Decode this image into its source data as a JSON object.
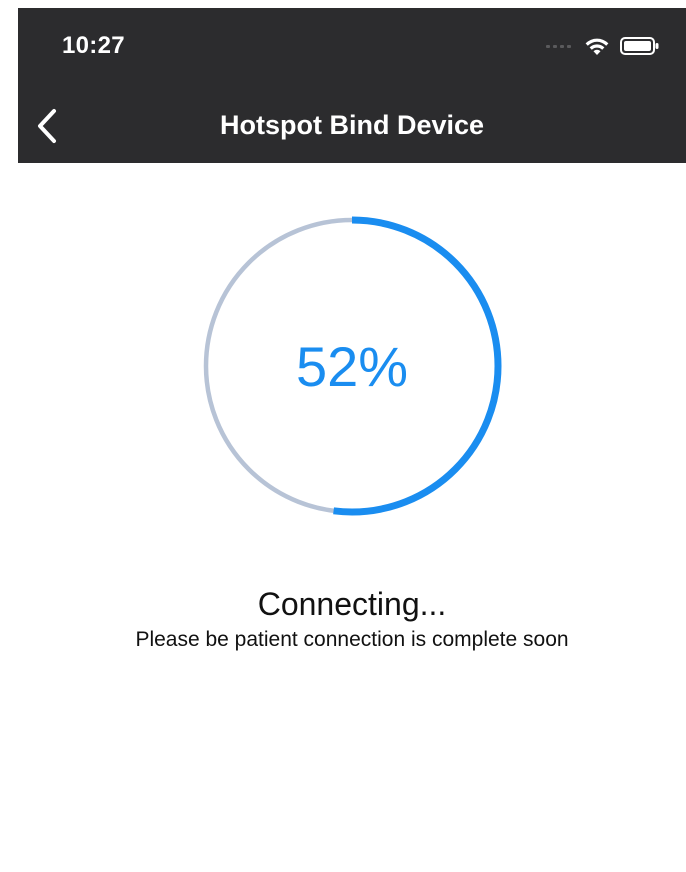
{
  "status_bar": {
    "time": "10:27"
  },
  "nav": {
    "title": "Hotspot Bind Device",
    "back_icon": "chevron-left-icon"
  },
  "progress": {
    "percent": 52,
    "label": "52%",
    "track_color": "#b7c3d6",
    "fill_color": "#1a8df0"
  },
  "status": {
    "title": "Connecting...",
    "subtitle": "Please be patient connection is complete soon"
  },
  "colors": {
    "header_bg": "#2c2c2e",
    "background": "#ffffff",
    "accent": "#1a8df0"
  }
}
